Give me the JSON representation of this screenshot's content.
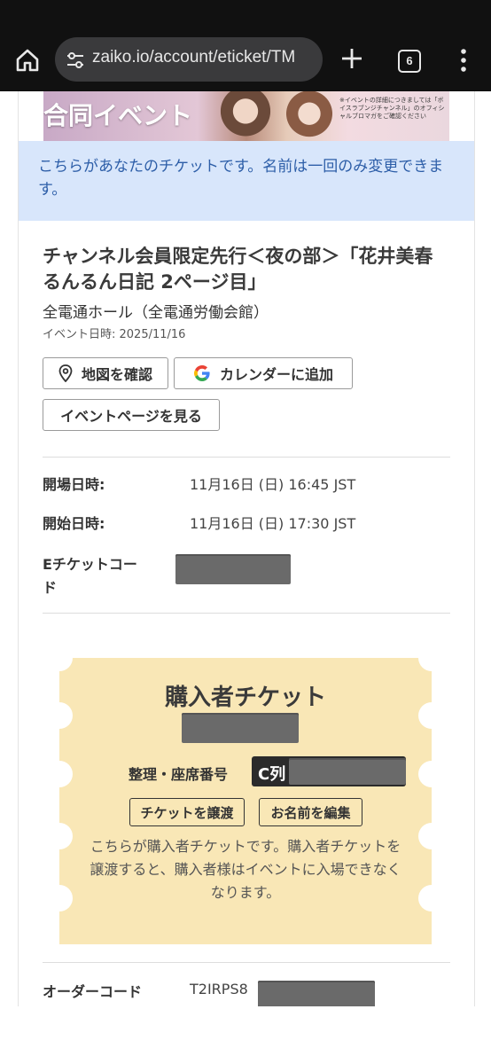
{
  "browser": {
    "url": "zaiko.io/account/eticket/TM",
    "tab_count": "6"
  },
  "banner": {
    "title": "合同イベント",
    "note": "※イベントの詳細につきましては「ボイスラブンジチャンネル」のオフィシャルブロマガをご確認ください"
  },
  "notice": "こちらがあなたのチケットです。名前は一回のみ変更できます。",
  "event": {
    "title": "チャンネル会員限定先行＜夜の部＞「花井美春 るんるん日記 2ページ目」",
    "venue": "全電通ホール（全電通労働会館）",
    "date": "イベント日時: 2025/11/16"
  },
  "buttons": {
    "map": "地図を確認",
    "calendar": "カレンダーに追加",
    "event_page": "イベントページを見る"
  },
  "details": {
    "open_label": "開場日時:",
    "open_value": "11月16日 (日) 16:45 JST",
    "start_label": "開始日時:",
    "start_value": "11月16日 (日) 17:30 JST",
    "eticket_label": "Eチケットコード"
  },
  "ticket": {
    "title": "購入者チケット",
    "seat_label": "整理・座席番号",
    "seat_prefix": "C列",
    "transfer_button": "チケットを譲渡",
    "edit_name_button": "お名前を編集",
    "description": "こちらが購入者チケットです。購入者チケットを譲渡すると、購入者様はイベントに入場できなくなります。"
  },
  "order": {
    "label": "オーダーコード",
    "value_prefix": "T2IRPS8"
  },
  "colors": {
    "notice_bg": "#d8e6fb",
    "notice_text": "#2d5ea8",
    "ticket_bg": "#f9e7b6",
    "chrome_bg": "#111111"
  }
}
